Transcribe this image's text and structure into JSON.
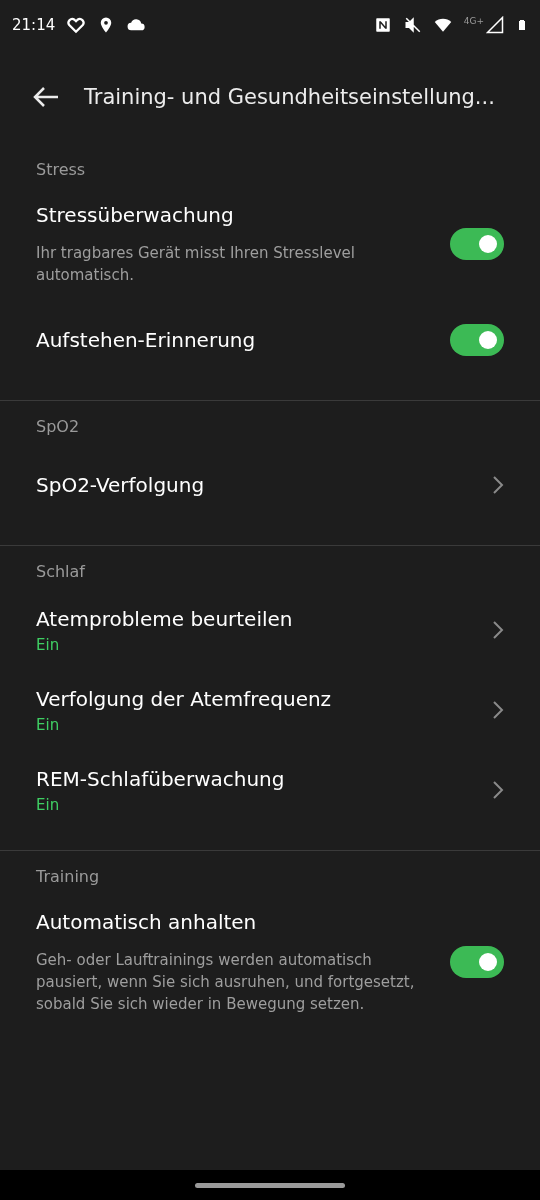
{
  "status_bar": {
    "time": "21:14",
    "network": "4G+"
  },
  "header": {
    "title": "Training- und Gesundheitseinstellung..."
  },
  "sections": [
    {
      "label": "Stress",
      "items": [
        {
          "kind": "toggle",
          "title": "Stressüberwachung",
          "description": "Ihr tragbares Gerät misst Ihren Stresslevel automatisch.",
          "on": true
        },
        {
          "kind": "toggle",
          "title": "Aufstehen-Erinnerung",
          "on": true
        }
      ]
    },
    {
      "label": "SpO2",
      "items": [
        {
          "kind": "link",
          "title": "SpO2-Verfolgung"
        }
      ]
    },
    {
      "label": "Schlaf",
      "items": [
        {
          "kind": "link",
          "title": "Atemprobleme beurteilen",
          "status": "Ein"
        },
        {
          "kind": "link",
          "title": "Verfolgung der Atemfrequenz",
          "status": "Ein"
        },
        {
          "kind": "link",
          "title": "REM-Schlafüberwachung",
          "status": "Ein"
        }
      ]
    },
    {
      "label": "Training",
      "items": [
        {
          "kind": "toggle",
          "title": "Automatisch anhalten",
          "description": "Geh- oder Lauftrainings werden automatisch pausiert, wenn Sie sich ausruhen, und fortgesetzt, sobald Sie sich wieder in Bewegung setzen.",
          "on": true
        }
      ]
    }
  ]
}
